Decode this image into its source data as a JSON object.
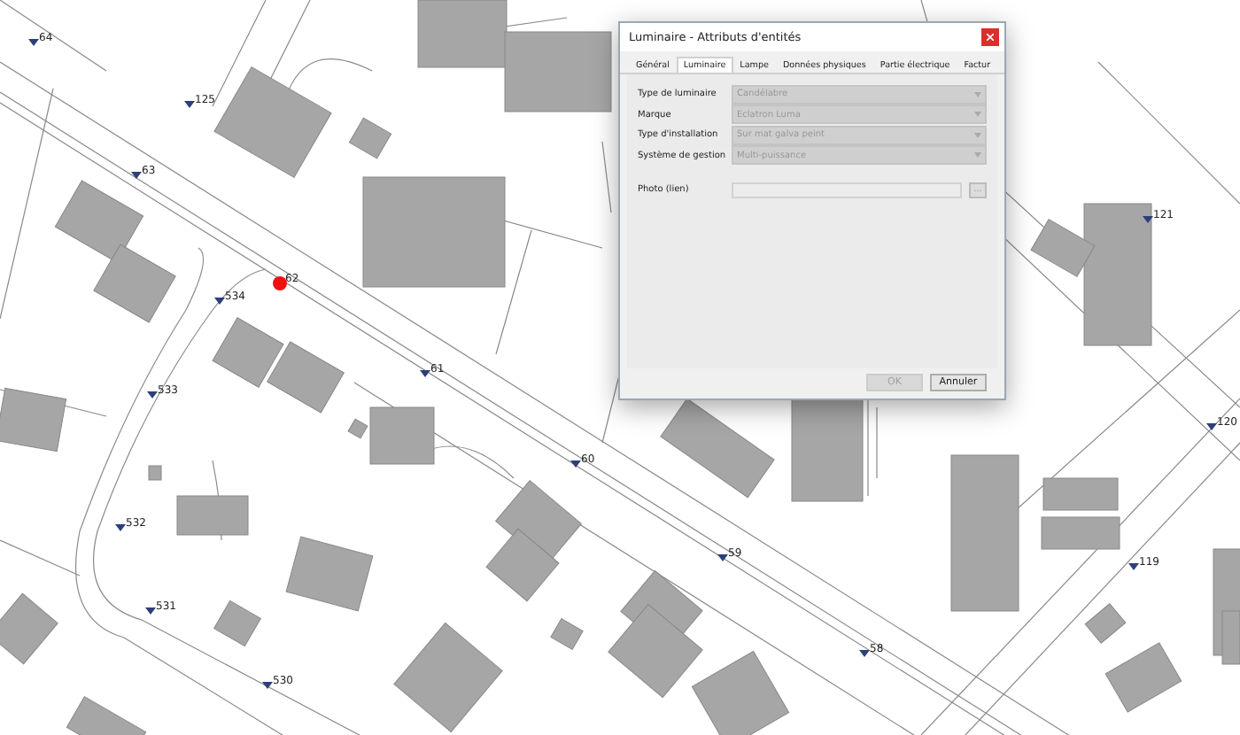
{
  "markers": [
    {
      "label": "64",
      "selected": false
    },
    {
      "label": "125",
      "selected": false
    },
    {
      "label": "63",
      "selected": false
    },
    {
      "label": "62",
      "selected": true
    },
    {
      "label": "534",
      "selected": false
    },
    {
      "label": "61",
      "selected": false
    },
    {
      "label": "533",
      "selected": false
    },
    {
      "label": "60",
      "selected": false
    },
    {
      "label": "532",
      "selected": false
    },
    {
      "label": "59",
      "selected": false
    },
    {
      "label": "531",
      "selected": false
    },
    {
      "label": "530",
      "selected": false
    },
    {
      "label": "58",
      "selected": false
    },
    {
      "label": "119",
      "selected": false
    },
    {
      "label": "121",
      "selected": false
    },
    {
      "label": "120",
      "selected": false
    }
  ],
  "dialog": {
    "title": "Luminaire - Attributs d'entités",
    "tabs": [
      {
        "label": "Général",
        "selected": false
      },
      {
        "label": "Luminaire",
        "selected": true
      },
      {
        "label": "Lampe",
        "selected": false
      },
      {
        "label": "Données physiques",
        "selected": false
      },
      {
        "label": "Partie électrique",
        "selected": false
      },
      {
        "label": "Factur",
        "selected": false
      }
    ],
    "fields": [
      {
        "kind": "select",
        "label": "Type de luminaire",
        "value": "Candélabre",
        "disabled": true
      },
      {
        "kind": "select",
        "label": "Marque",
        "value": "Eclatron Luma",
        "disabled": true
      },
      {
        "kind": "select",
        "label": "Type d'installation",
        "value": "Sur mat galva peint",
        "disabled": true
      },
      {
        "kind": "select",
        "label": "Système de gestion",
        "value": "Multi-puissance",
        "disabled": true
      },
      {
        "kind": "file",
        "label": "Photo (lien)",
        "button": "...",
        "disabled": true
      }
    ],
    "buttons": [
      {
        "label": "OK",
        "disabled": true
      },
      {
        "label": "Annuler",
        "disabled": false
      }
    ]
  }
}
